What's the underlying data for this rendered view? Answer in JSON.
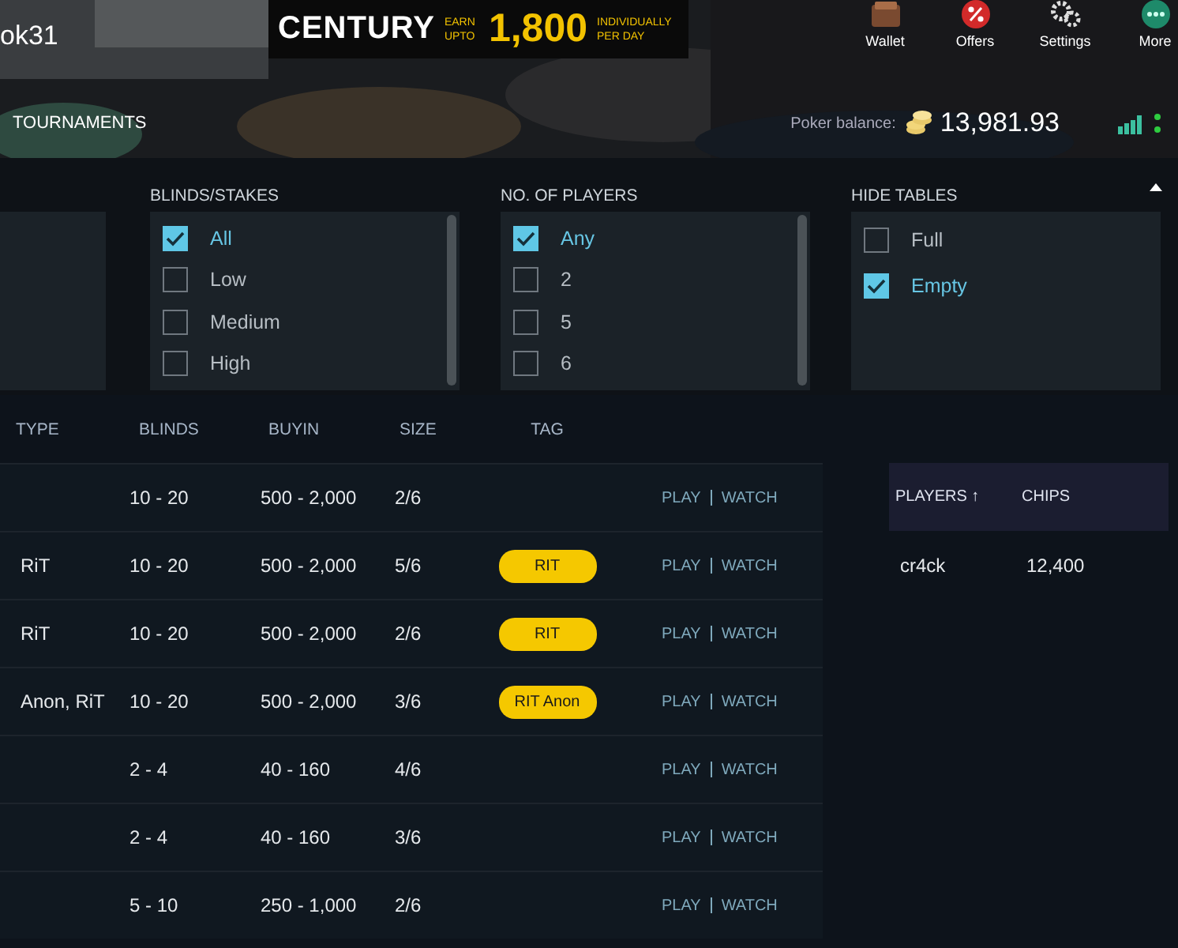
{
  "header": {
    "username": "ok31",
    "banner": {
      "brand": "CENTURY",
      "earn": "EARN UPTO",
      "amount": "1,800",
      "per_day": "INDIVIDUALLY PER DAY"
    },
    "nav": [
      {
        "label": "Wallet",
        "kind": "wallet"
      },
      {
        "label": "Offers",
        "kind": "offers"
      },
      {
        "label": "Settings",
        "kind": "settings"
      },
      {
        "label": "More",
        "kind": "more"
      }
    ],
    "tab": "TOURNAMENTS",
    "balance_label": "Poker balance:",
    "balance": "13,981.93"
  },
  "filters": [
    {
      "title": "BLINDS/STAKES",
      "scroll": true,
      "options": [
        {
          "label": "All",
          "checked": true
        },
        {
          "label": "Low",
          "checked": false
        },
        {
          "label": "Medium",
          "checked": false
        },
        {
          "label": "High",
          "checked": false
        }
      ]
    },
    {
      "title": "NO. OF PLAYERS",
      "scroll": true,
      "options": [
        {
          "label": "Any",
          "checked": true
        },
        {
          "label": "2",
          "checked": false
        },
        {
          "label": "5",
          "checked": false
        },
        {
          "label": "6",
          "checked": false
        }
      ]
    },
    {
      "title": "HIDE TABLES",
      "scroll": false,
      "options": [
        {
          "label": "Full",
          "checked": false
        },
        {
          "label": "Empty",
          "checked": true
        }
      ]
    }
  ],
  "table": {
    "columns": [
      "TYPE",
      "BLINDS",
      "BUYIN",
      "SIZE",
      "TAG"
    ],
    "rows": [
      {
        "type": "",
        "blinds": "10 - 20",
        "buyin": "500 - 2,000",
        "size": "2/6",
        "tag": "",
        "play": "PLAY",
        "watch": "WATCH"
      },
      {
        "type": "RiT",
        "blinds": "10 - 20",
        "buyin": "500 - 2,000",
        "size": "5/6",
        "tag": "RIT",
        "play": "PLAY",
        "watch": "WATCH"
      },
      {
        "type": "RiT",
        "blinds": "10 - 20",
        "buyin": "500 - 2,000",
        "size": "2/6",
        "tag": "RIT",
        "play": "PLAY",
        "watch": "WATCH"
      },
      {
        "type": "Anon, RiT",
        "blinds": "10 - 20",
        "buyin": "500 - 2,000",
        "size": "3/6",
        "tag": "RIT Anon",
        "play": "PLAY",
        "watch": "WATCH"
      },
      {
        "type": "",
        "blinds": "2 - 4",
        "buyin": "40 - 160",
        "size": "4/6",
        "tag": "",
        "play": "PLAY",
        "watch": "WATCH"
      },
      {
        "type": "",
        "blinds": "2 - 4",
        "buyin": "40 - 160",
        "size": "3/6",
        "tag": "",
        "play": "PLAY",
        "watch": "WATCH"
      },
      {
        "type": "",
        "blinds": "5 - 10",
        "buyin": "250 - 1,000",
        "size": "2/6",
        "tag": "",
        "play": "PLAY",
        "watch": "WATCH"
      }
    ]
  },
  "players": {
    "columns": [
      "PLAYERS ↑",
      "CHIPS"
    ],
    "rows": [
      {
        "name": "cr4ck",
        "chips": "12,400"
      }
    ]
  }
}
